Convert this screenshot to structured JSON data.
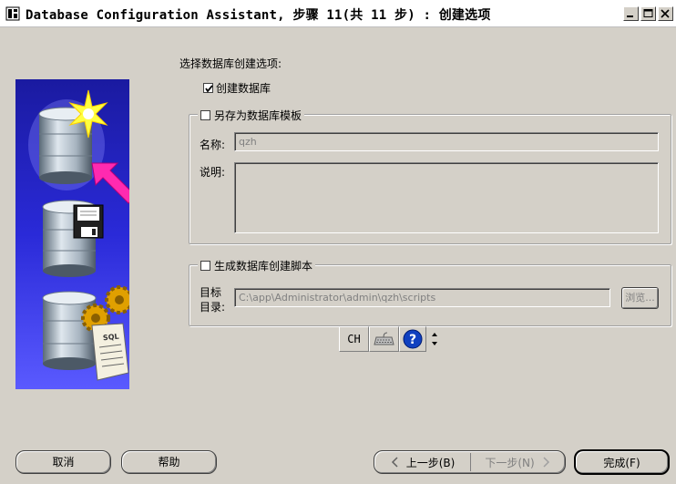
{
  "window": {
    "title": "Database Configuration Assistant, 步骤 11(共 11 步) : 创建选项"
  },
  "prompt": "选择数据库创建选项:",
  "create_db": {
    "label": "创建数据库",
    "checked": true
  },
  "template_group": {
    "label": "另存为数据库模板",
    "checked": false,
    "name_label": "名称:",
    "name_value": "qzh",
    "desc_label": "说明:",
    "desc_value": ""
  },
  "script_group": {
    "label": "生成数据库创建脚本",
    "checked": false,
    "dir_label_1": "目标",
    "dir_label_2": "目录:",
    "dir_value": "C:\\app\\Administrator\\admin\\qzh\\scripts",
    "browse_label": "浏览..."
  },
  "ime_toolbar": {
    "lang_label": "CH",
    "keyboard": "keyboard-icon",
    "help": "help-icon"
  },
  "footer": {
    "cancel": "取消",
    "help": "帮助",
    "back": "上一步(B)",
    "next": "下一步(N)",
    "finish": "完成(F)"
  }
}
